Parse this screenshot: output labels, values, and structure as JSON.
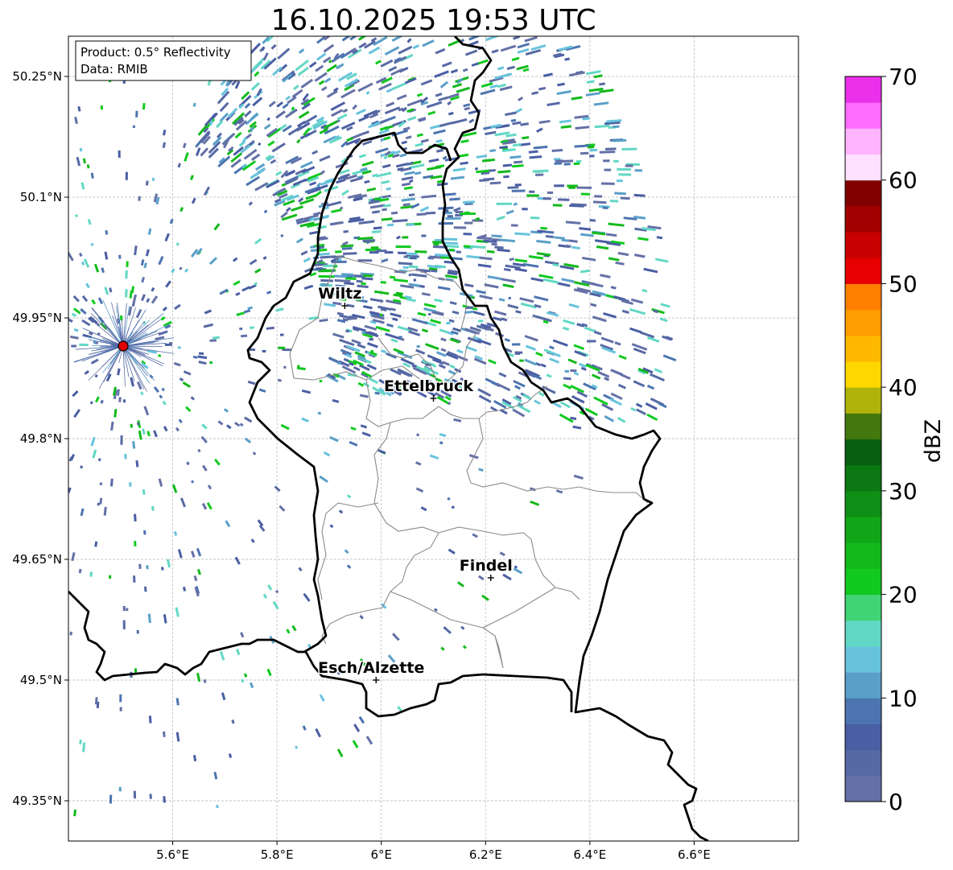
{
  "title": "16.10.2025 19:53 UTC",
  "info_box": {
    "product": "Product: 0.5° Reflectivity",
    "data": "Data: RMIB"
  },
  "axes": {
    "lon_range": [
      5.4,
      6.8
    ],
    "lat_range": [
      49.3,
      50.3
    ],
    "x_ticks": [
      {
        "value": 5.6,
        "label": "5.6°E"
      },
      {
        "value": 5.8,
        "label": "5.8°E"
      },
      {
        "value": 6.0,
        "label": "6°E"
      },
      {
        "value": 6.2,
        "label": "6.2°E"
      },
      {
        "value": 6.4,
        "label": "6.4°E"
      },
      {
        "value": 6.6,
        "label": "6.6°E"
      }
    ],
    "y_ticks": [
      {
        "value": 50.25,
        "label": "50.25°N"
      },
      {
        "value": 50.1,
        "label": "50.1°N"
      },
      {
        "value": 49.95,
        "label": "49.95°N"
      },
      {
        "value": 49.8,
        "label": "49.8°N"
      },
      {
        "value": 49.65,
        "label": "49.65°N"
      },
      {
        "value": 49.5,
        "label": "49.5°N"
      },
      {
        "value": 49.35,
        "label": "49.35°N"
      }
    ],
    "grid": true
  },
  "radar_site": {
    "lon": 5.505,
    "lat": 49.915,
    "color": "#e00000"
  },
  "cities": [
    {
      "name": "Wiltz",
      "lon": 5.93,
      "lat": 49.965
    },
    {
      "name": "Ettelbruck",
      "lon": 6.1,
      "lat": 49.85
    },
    {
      "name": "Findel",
      "lon": 6.21,
      "lat": 49.627
    },
    {
      "name": "Esch/Alzette",
      "lon": 5.99,
      "lat": 49.5
    }
  ],
  "colorbar": {
    "label": "dBZ",
    "min": 0,
    "max": 70,
    "ticks": [
      {
        "value": 0,
        "label": "0"
      },
      {
        "value": 10,
        "label": "10"
      },
      {
        "value": 20,
        "label": "20"
      },
      {
        "value": 30,
        "label": "30"
      },
      {
        "value": 40,
        "label": "40"
      },
      {
        "value": 50,
        "label": "50"
      },
      {
        "value": 60,
        "label": "60"
      },
      {
        "value": 70,
        "label": "70"
      }
    ],
    "colors": [
      "#6470a6",
      "#5769a4",
      "#4a5ea3",
      "#4c74b0",
      "#5a9fc8",
      "#67c3dc",
      "#62d8c4",
      "#40d474",
      "#11c91f",
      "#13b91b",
      "#11a618",
      "#0f8f16",
      "#0c7813",
      "#085f10",
      "#42780d",
      "#b0b30a",
      "#ffd700",
      "#ffb800",
      "#ff9c00",
      "#ff7f00",
      "#e60000",
      "#c80000",
      "#a20000",
      "#800000",
      "#ffe0ff",
      "#ffb4ff",
      "#ff6cff",
      "#ea30ea"
    ]
  }
}
